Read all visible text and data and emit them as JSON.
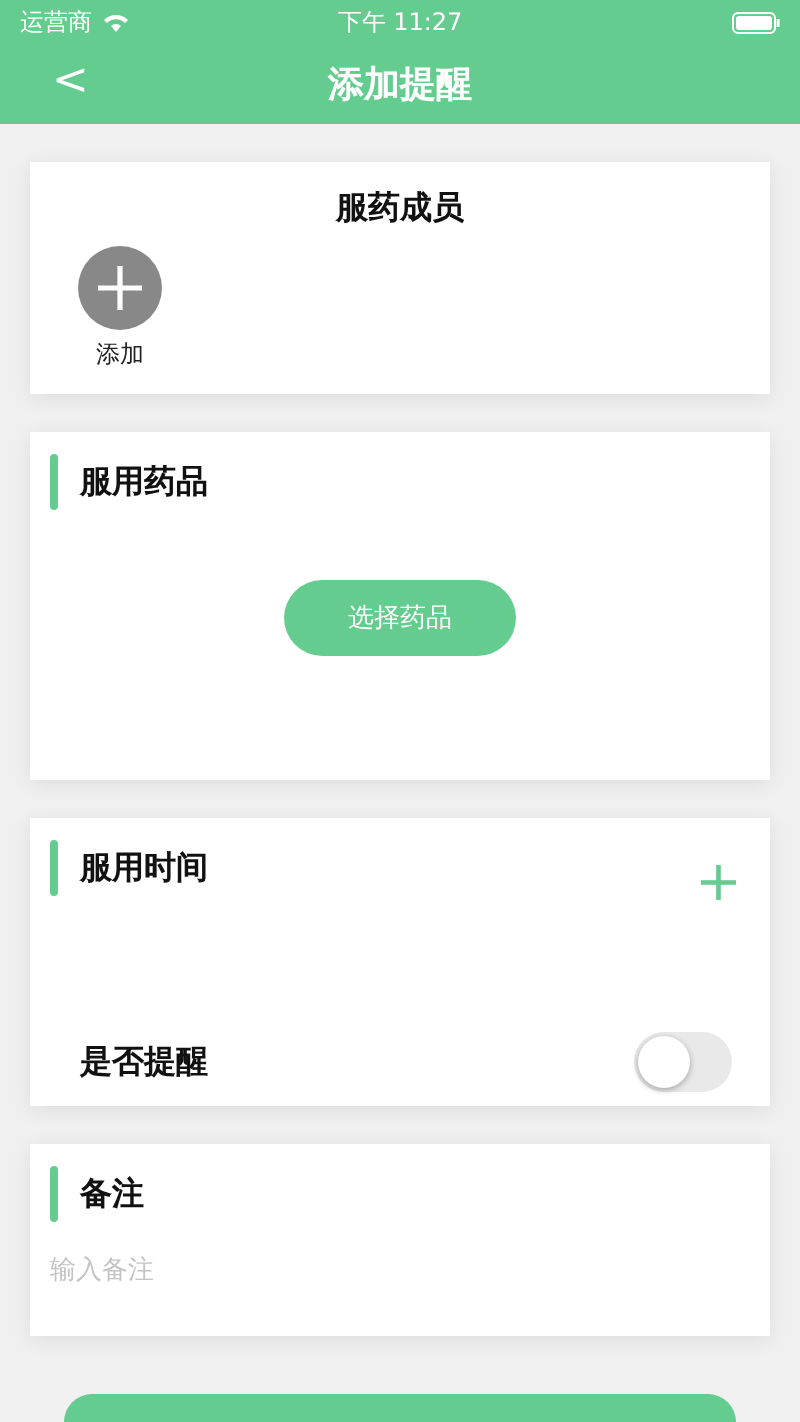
{
  "status_bar": {
    "carrier": "运营商",
    "time": "下午 11:27"
  },
  "header": {
    "back": "<",
    "title": "添加提醒"
  },
  "members": {
    "title": "服药成员",
    "add_label": "添加"
  },
  "medicine": {
    "title": "服用药品",
    "button": "选择药品"
  },
  "time": {
    "title": "服用时间",
    "add": "+",
    "reminder_label": "是否提醒",
    "reminder_on": false
  },
  "note": {
    "title": "备注",
    "placeholder": "输入备注"
  }
}
